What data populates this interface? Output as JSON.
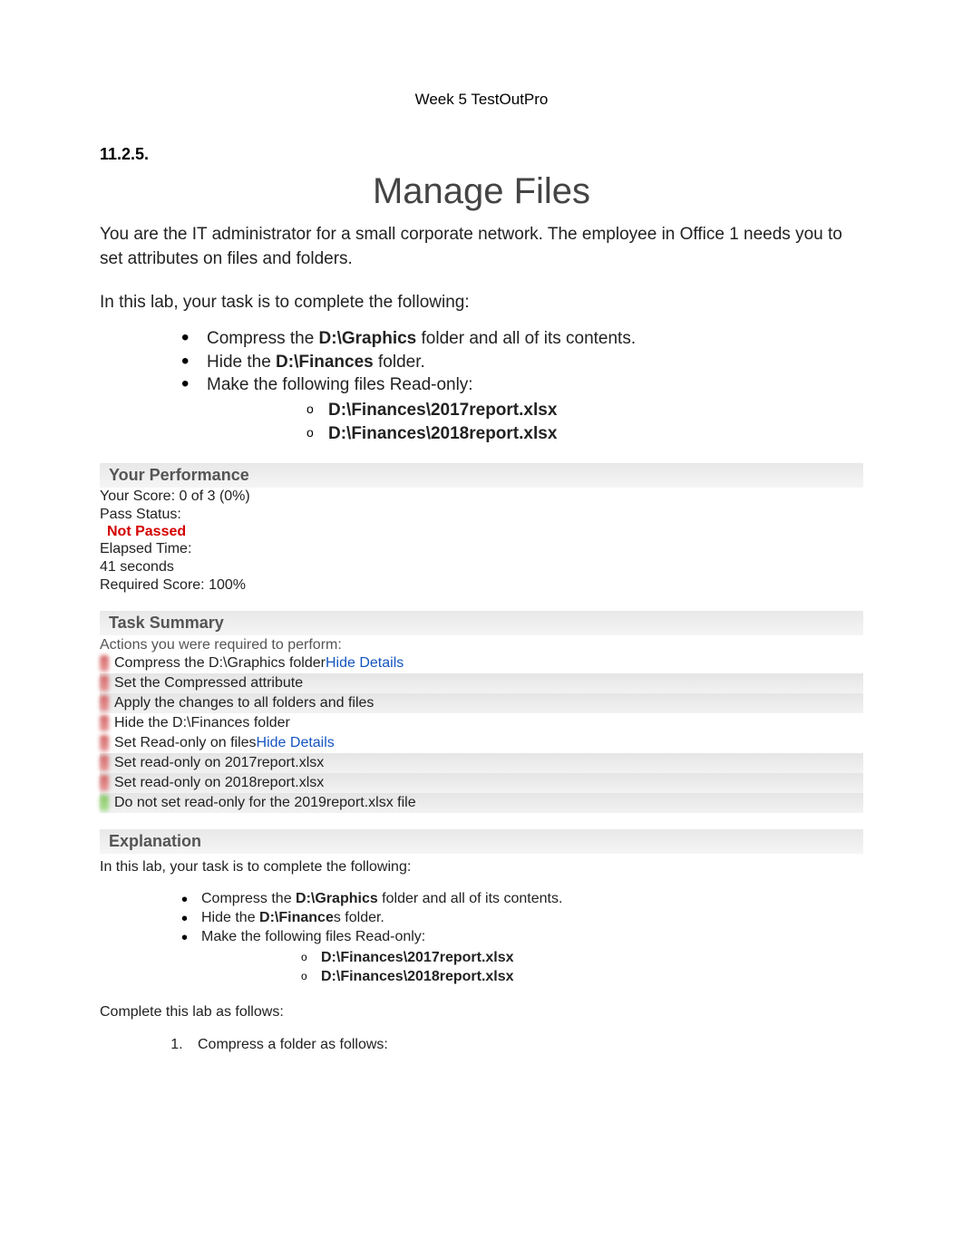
{
  "header": {
    "title": "Week 5 TestOutPro"
  },
  "section_number": "11.2.5.",
  "main_title": "Manage Files",
  "intro": "You are the IT administrator for a small corporate network. The employee in Office 1 needs you to set attributes on files and folders.",
  "task_intro": "In this lab, your task is to complete the following:",
  "bullets": {
    "b1_pre": "Compress the ",
    "b1_bold": "D:\\Graphics",
    "b1_post": " folder and all of its contents.",
    "b2_pre": "Hide the ",
    "b2_bold": "D:\\Finances",
    "b2_post": " folder.",
    "b3": "Make the following files Read-only:",
    "sub1": "D:\\Finances\\2017report.xlsx",
    "sub2": "D:\\Finances\\2018report.xlsx"
  },
  "performance": {
    "header": "Your Performance",
    "score": "Your Score: 0 of 3 (0%)",
    "pass_label": "Pass Status:",
    "pass_value": "Not Passed",
    "elapsed_label": "Elapsed Time:",
    "elapsed_value": "41 seconds",
    "required": "Required Score: 100%"
  },
  "task_summary": {
    "header": "Task Summary",
    "intro": "Actions you were required to perform:",
    "t1_text": "Compress the D:\\Graphics folder",
    "t1_link": "Hide Details",
    "t1a": "Set the Compressed attribute",
    "t1b": "Apply the changes to all folders and files",
    "t2": "Hide the D:\\Finances folder",
    "t3_text": "Set Read-only on files",
    "t3_link": "Hide Details",
    "t3a": "Set read-only on 2017report.xlsx",
    "t3b": "Set read-only on 2018report.xlsx",
    "t3c": "Do not set read-only for the 2019report.xlsx file"
  },
  "explanation": {
    "header": "Explanation",
    "intro": "In this lab, your task is to complete the following:",
    "b1_pre": "Compress the ",
    "b1_bold": "D:\\Graphics",
    "b1_post": " folder and all of its contents.",
    "b2_pre": "Hide the ",
    "b2_bold": "D:\\Finance",
    "b2_post": "s folder.",
    "b3": "Make the following files Read-only:",
    "sub1": "D:\\Finances\\2017report.xlsx",
    "sub2": "D:\\Finances\\2018report.xlsx",
    "complete": "Complete this lab as follows:",
    "step1": "Compress a folder as follows:"
  }
}
